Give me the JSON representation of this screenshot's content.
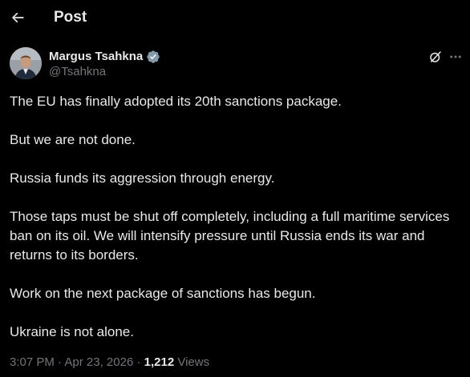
{
  "header": {
    "title": "Post"
  },
  "author": {
    "name": "Margus Tsahkna",
    "handle": "@Tsahkna",
    "verified_color": "#829aab"
  },
  "post": {
    "paragraphs": [
      "The EU has finally adopted its 20th sanctions package.",
      "But we are not done.",
      "Russia funds its aggression through energy.",
      "Those taps must be shut off completely, including a full maritime services ban on its oil. We will intensify pressure until Russia ends its war and returns to its borders.",
      "Work on the next package of sanctions has begun.",
      "Ukraine is not alone."
    ]
  },
  "meta": {
    "time": "3:07 PM",
    "separator": "·",
    "date": "Apr 23, 2026",
    "views_count": "1,212",
    "views_label": "Views"
  },
  "icons": {
    "back": "arrow-left-icon",
    "verified": "verified-badge-icon",
    "grok": "grok-icon",
    "more": "more-horizontal-icon"
  },
  "colors": {
    "background": "#000000",
    "text_primary": "#e7e9ea",
    "text_secondary": "#71767b"
  }
}
